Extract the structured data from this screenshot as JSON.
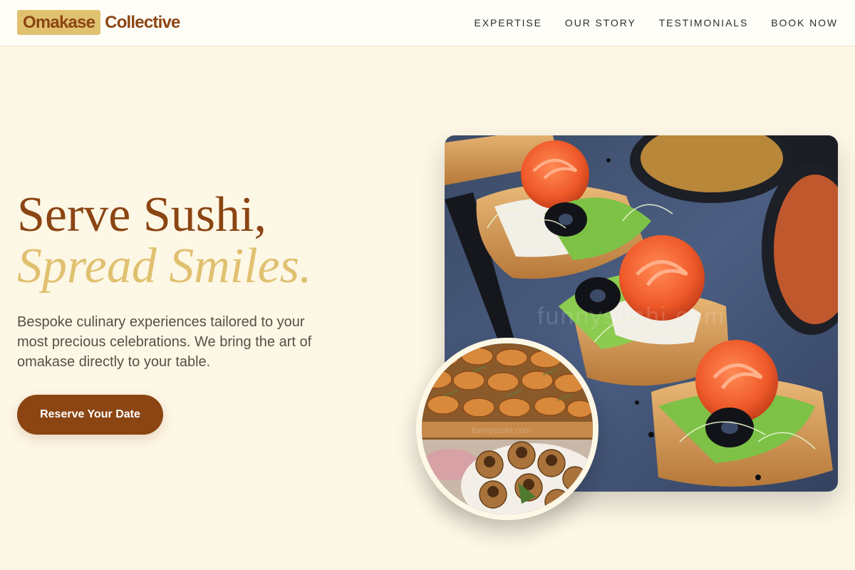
{
  "brand": {
    "mark": "Omakase",
    "word": "Collective"
  },
  "nav": {
    "items": [
      {
        "label": "EXPERTISE"
      },
      {
        "label": "OUR STORY"
      },
      {
        "label": "TESTIMONIALS"
      },
      {
        "label": "BOOK NOW"
      }
    ]
  },
  "hero": {
    "title_line1": "Serve Sushi,",
    "title_line2": "Spread Smiles.",
    "description": "Bespoke culinary experiences tailored to your most precious celebrations. We bring the art of omakase directly to your table.",
    "cta_label": "Reserve Your Date"
  },
  "images": {
    "main_alt": "Smoked salmon rose crostini with olive and greens on slate",
    "main_watermark": "funnysushi.com",
    "inset_alt": "Croissant sandwiches and tartlets platter",
    "inset_watermark": "funnysushi.com"
  },
  "colors": {
    "background": "#fdf7e6",
    "accent_brown": "#8b4513",
    "accent_gold": "#e0c170"
  }
}
